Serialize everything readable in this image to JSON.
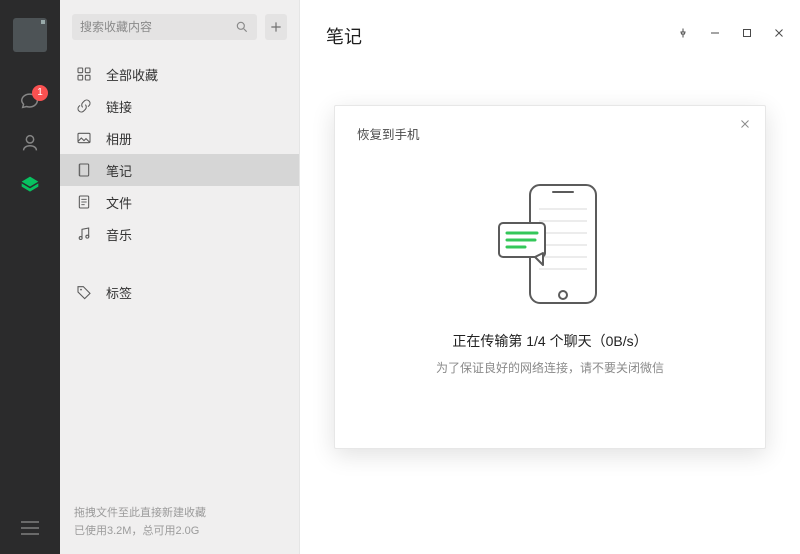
{
  "rail": {
    "chat_badge": "1"
  },
  "search": {
    "placeholder": "搜索收藏内容"
  },
  "sidebar": {
    "items": [
      {
        "label": "全部收藏"
      },
      {
        "label": "链接"
      },
      {
        "label": "相册"
      },
      {
        "label": "笔记"
      },
      {
        "label": "文件"
      },
      {
        "label": "音乐"
      },
      {
        "label": "标签"
      }
    ]
  },
  "footer": {
    "line1": "拖拽文件至此直接新建收藏",
    "line2": "已使用3.2M，总可用2.0G"
  },
  "main": {
    "title": "笔记"
  },
  "modal": {
    "title": "恢复到手机",
    "status_line1": "正在传输第 1/4 个聊天（0B/s）",
    "status_line2": "为了保证良好的网络连接，请不要关闭微信"
  }
}
